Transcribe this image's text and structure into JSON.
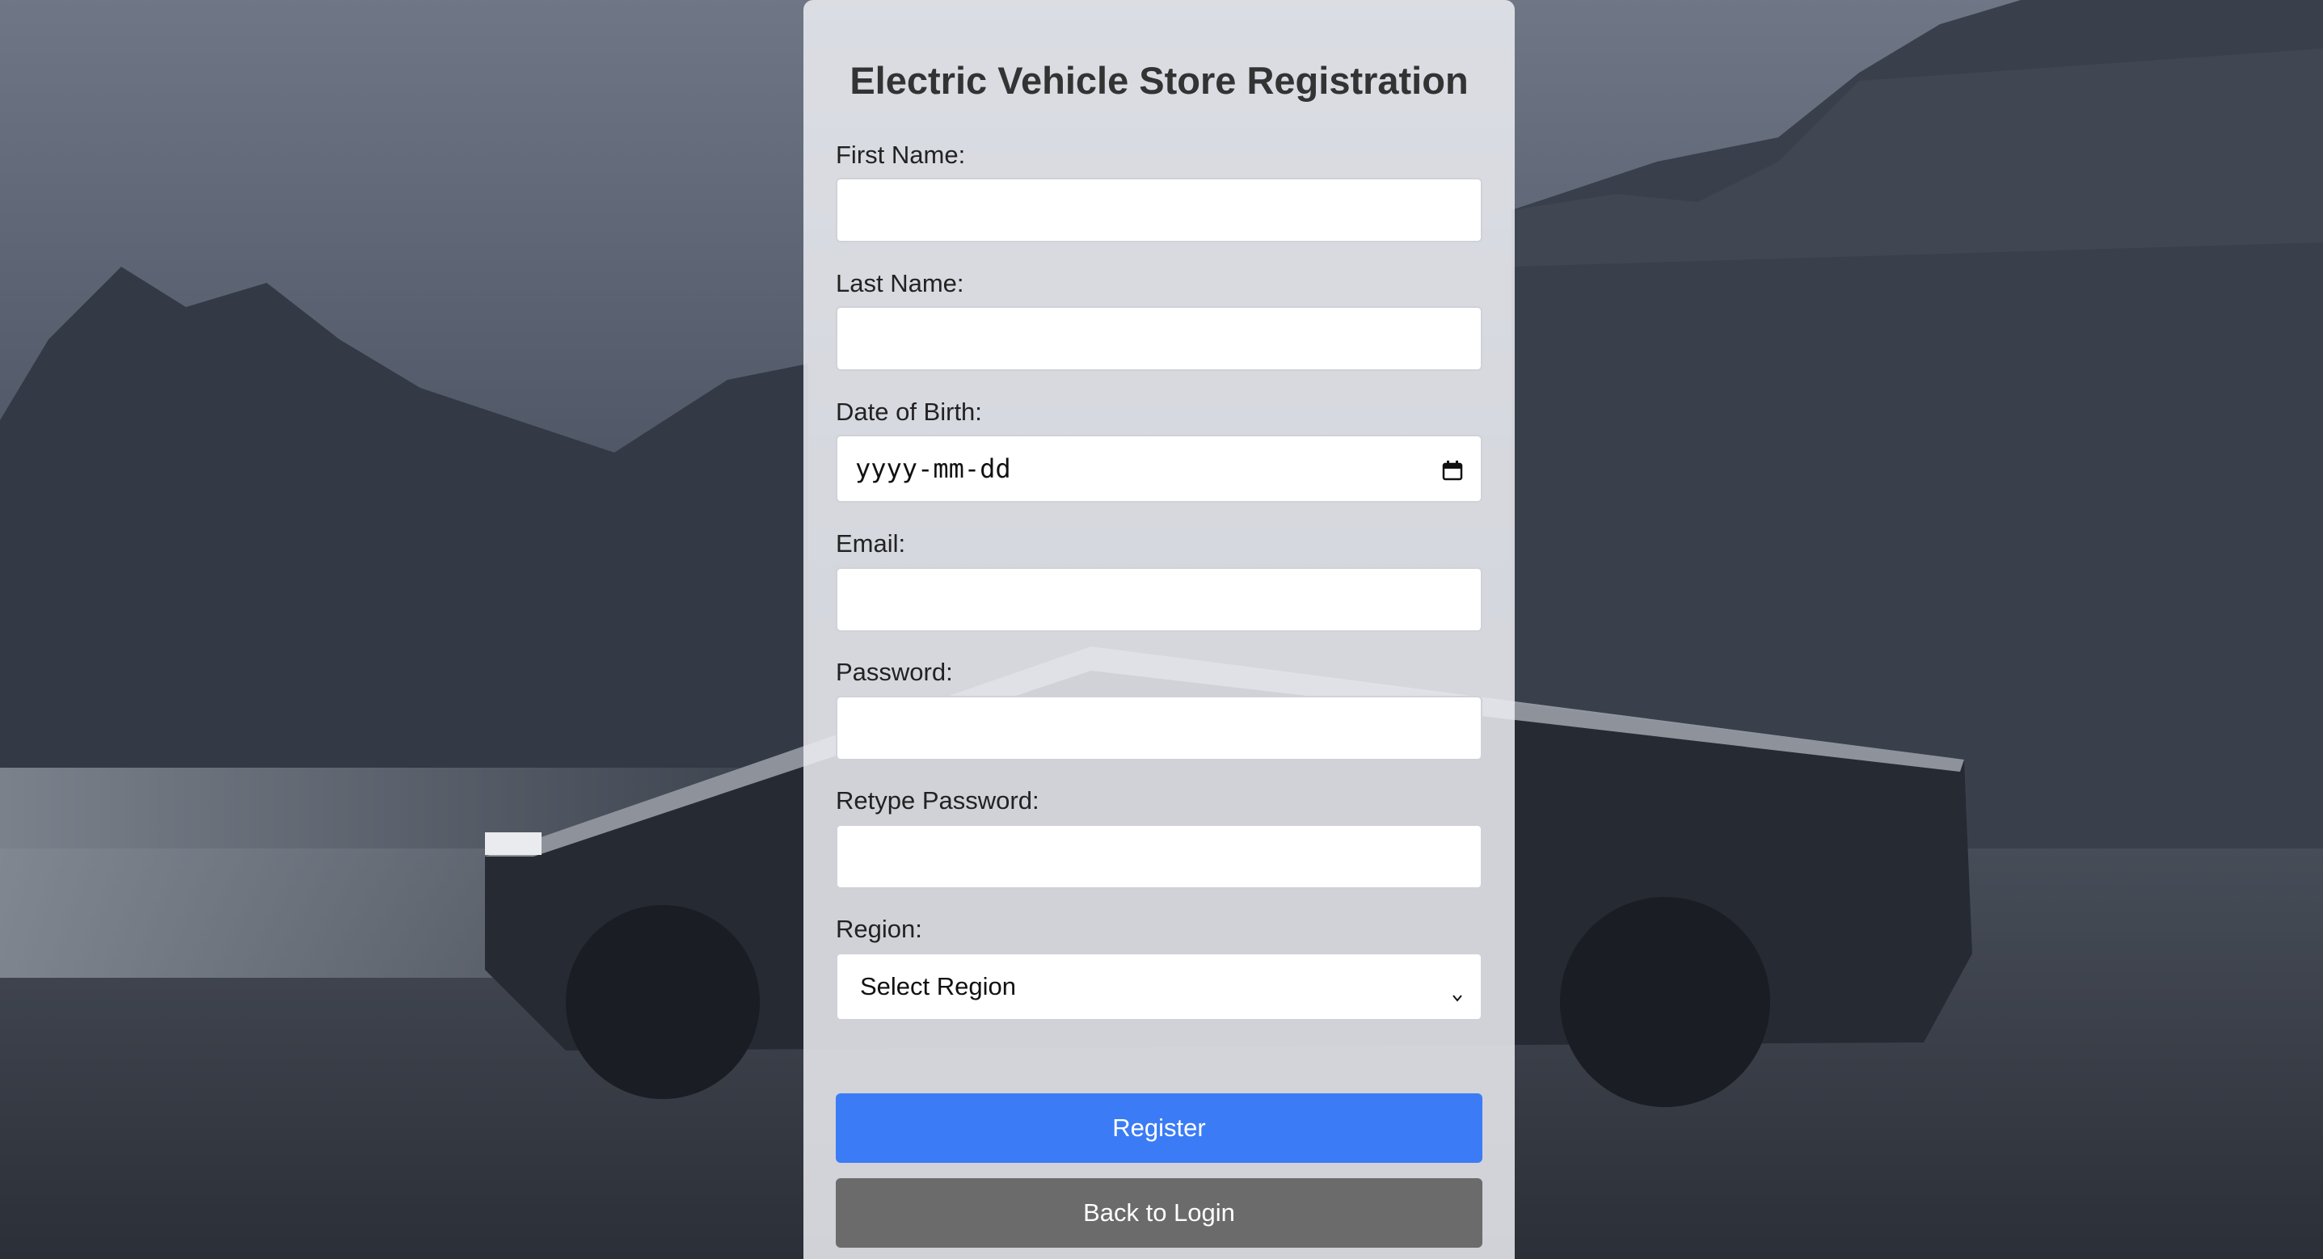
{
  "form": {
    "title": "Electric Vehicle Store Registration",
    "first_name_label": "First Name:",
    "last_name_label": "Last Name:",
    "dob_label": "Date of Birth:",
    "dob_placeholder": "yyyy-mm-dd",
    "email_label": "Email:",
    "password_label": "Password:",
    "retype_password_label": "Retype Password:",
    "region_label": "Region:",
    "region_selected": "Select Region",
    "register_label": "Register",
    "back_label": "Back to Login"
  },
  "colors": {
    "primary": "#3b7cf6",
    "secondary": "#6b6b6b"
  },
  "icons": {
    "date": "calendar-icon",
    "select": "chevron-down-icon"
  }
}
